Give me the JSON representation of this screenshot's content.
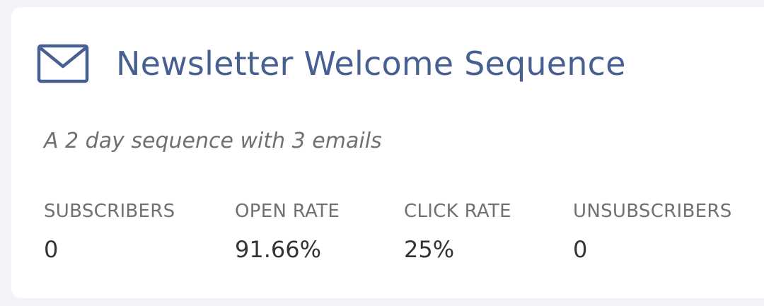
{
  "sequence": {
    "icon": "envelope-icon",
    "title": "Newsletter Welcome Sequence",
    "description": "A 2 day sequence with 3 emails",
    "accent_color": "#475f91"
  },
  "stats": [
    {
      "label": "SUBSCRIBERS",
      "value": "0"
    },
    {
      "label": "OPEN RATE",
      "value": "91.66%"
    },
    {
      "label": "CLICK RATE",
      "value": "25%"
    },
    {
      "label": "UNSUBSCRIBERS",
      "value": "0"
    }
  ]
}
